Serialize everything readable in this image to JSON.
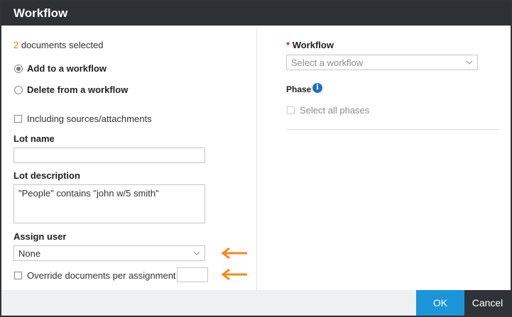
{
  "dialog": {
    "title": "Workflow",
    "ok_label": "OK",
    "cancel_label": "Cancel"
  },
  "left": {
    "selection_count": "2",
    "selection_text": " documents selected",
    "radio_options": [
      {
        "label": "Add to a workflow",
        "checked": true
      },
      {
        "label": "Delete from a workflow",
        "checked": false
      }
    ],
    "include_sources_label": "Including sources/attachments",
    "lot_name_label": "Lot name",
    "lot_name_value": "",
    "lot_description_label": "Lot description",
    "lot_description_value": "\"People\" contains \"john w/5 smith\"",
    "assign_user_label": "Assign user",
    "assign_user_value": "None",
    "override_label": "Override documents per assignment",
    "override_value": ""
  },
  "right": {
    "workflow_required_mark": "*",
    "workflow_label": "Workflow",
    "workflow_placeholder": "Select a workflow",
    "phase_label": "Phase",
    "select_all_phases_label": "Select all phases"
  },
  "colors": {
    "titlebar": "#2d3136",
    "accent_orange": "#f28a1a",
    "ok_button": "#1b95d9",
    "cancel_button": "#2f3337",
    "required": "#d9202a",
    "info_icon": "#1b70c4"
  },
  "icons": {
    "info": "info-icon",
    "chevron": "chevron-down-icon",
    "arrow": "arrow-left-icon"
  }
}
